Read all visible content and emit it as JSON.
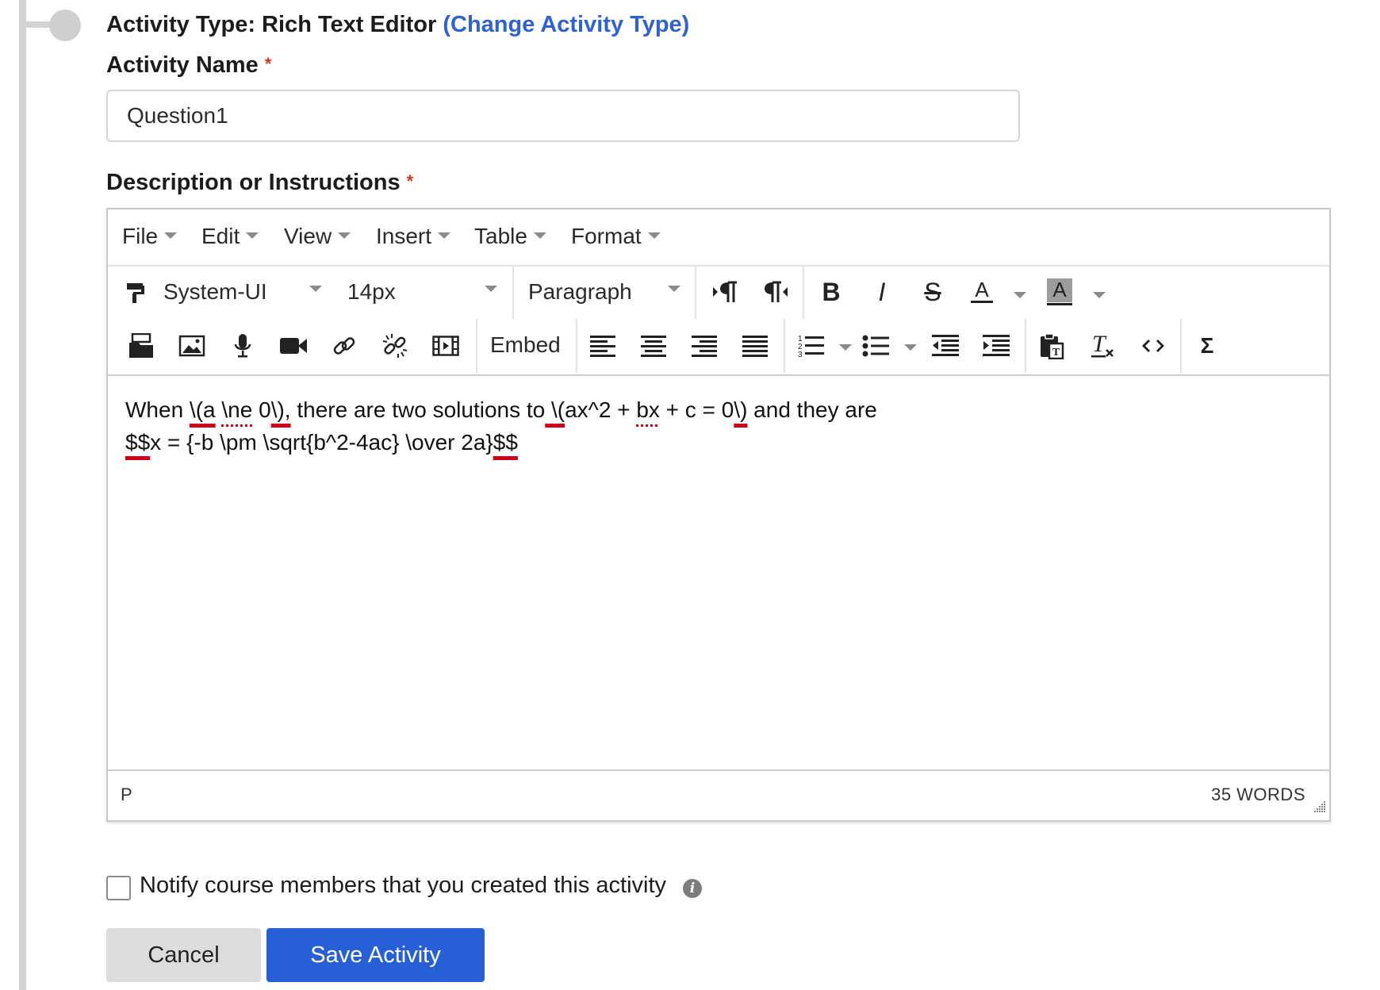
{
  "activity_type": {
    "prefix": "Activity Type: Rich Text Editor",
    "change_link": "(Change Activity Type)"
  },
  "activity_name": {
    "label": "Activity Name",
    "required_mark": "*",
    "value": "Question1"
  },
  "description": {
    "label": "Description or Instructions",
    "required_mark": "*"
  },
  "editor": {
    "menus": [
      "File",
      "Edit",
      "View",
      "Insert",
      "Table",
      "Format"
    ],
    "font_family": "System-UI",
    "font_size": "14px",
    "block_format": "Paragraph",
    "embed_label": "Embed",
    "content": {
      "line1": {
        "p1": "When ",
        "p2": "\\(a",
        "p3": " ",
        "p4": "\\ne",
        "p5": " 0",
        "p6": "\\),",
        "p7": " there are two solutions to",
        "p8": " \\(",
        "p9": "ax^2 + ",
        "p10": "bx",
        "p11": " + c = 0",
        "p12": "\\)",
        "p13": " and they are"
      },
      "line2": {
        "p1": "$$",
        "p2": "x = {-b \\pm \\sqrt{b^2-4ac} \\over 2a}",
        "p3": "$$"
      }
    },
    "status_path": "P",
    "word_count": "35 WORDS"
  },
  "notify": {
    "label": "Notify course members that you created this activity",
    "checked": false,
    "info_glyph": "i"
  },
  "buttons": {
    "cancel": "Cancel",
    "save": "Save Activity"
  },
  "colors": {
    "link": "#2f62d0",
    "primary_button": "#2760d6",
    "required": "#d9341f",
    "spellcheck": "#d0021b"
  }
}
